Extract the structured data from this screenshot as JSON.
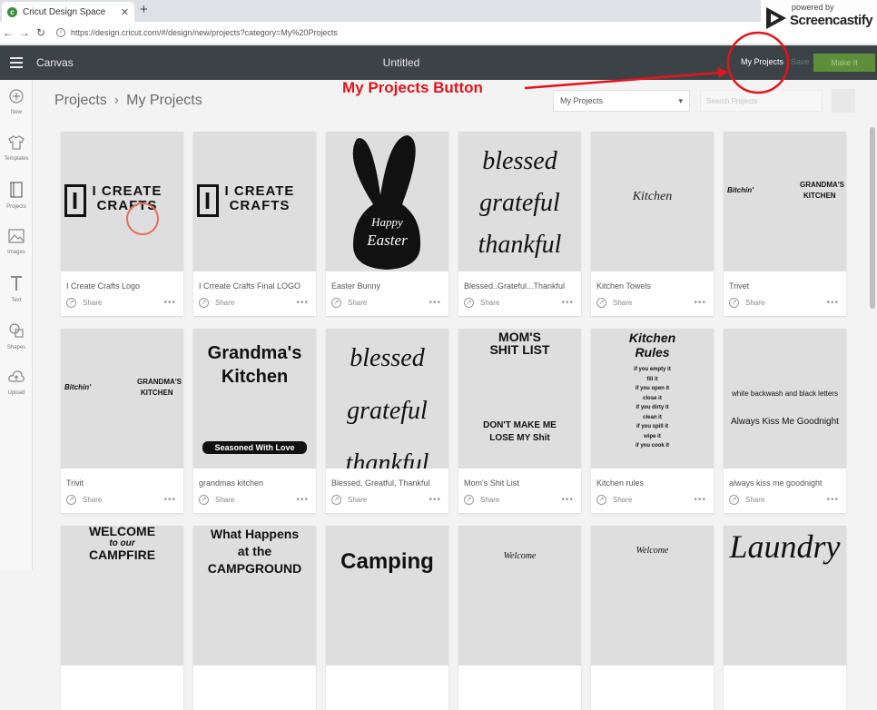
{
  "browser": {
    "tab_title": "Cricut Design Space",
    "url": "https://design.cricut.com/#/design/new/projects?category=My%20Projects"
  },
  "watermark": {
    "powered": "powered by",
    "brand": "Screencastify"
  },
  "appbar": {
    "canvas_label": "Canvas",
    "title": "Untitled",
    "my_projects": "My Projects",
    "save": "Save",
    "make_it": "Make It"
  },
  "sidebar": {
    "items": [
      {
        "label": "New",
        "icon": "plus-icon"
      },
      {
        "label": "Templates",
        "icon": "shirt-icon"
      },
      {
        "label": "Projects",
        "icon": "projects-icon"
      },
      {
        "label": "Images",
        "icon": "image-icon"
      },
      {
        "label": "Text",
        "icon": "text-icon"
      },
      {
        "label": "Shapes",
        "icon": "shapes-icon"
      },
      {
        "label": "Upload",
        "icon": "upload-icon"
      }
    ]
  },
  "header": {
    "crumb_root": "Projects",
    "crumb_sep": "›",
    "crumb_current": "My Projects",
    "select_value": "My Projects",
    "search_placeholder": "Search Projects"
  },
  "annotation": {
    "label": "My Projects Button"
  },
  "share_label": "Share",
  "more_label": "•••",
  "projects": [
    {
      "name": "I Create Crafts Logo",
      "art": [
        "I CREATE",
        "CRAFTS"
      ]
    },
    {
      "name": "I Crreate Crafts Final LOGO",
      "art": [
        "I CREATE",
        "CRAFTS"
      ]
    },
    {
      "name": "Easter Bunny",
      "art": [
        "Happy",
        "Easter"
      ]
    },
    {
      "name": "Blessed..Grateful...Thankful",
      "art": [
        "blessed",
        "grateful",
        "thankful"
      ]
    },
    {
      "name": "Kitchen Towels",
      "art": [
        "Kitchen"
      ]
    },
    {
      "name": "Trivet",
      "art": [
        "Bitchin'",
        "GRANDMA'S",
        "KITCHEN"
      ]
    },
    {
      "name": "Trivit",
      "art": [
        "Bitchin'",
        "GRANDMA'S",
        "KITCHEN"
      ]
    },
    {
      "name": "grandmas kitchen",
      "art": [
        "Grandma's",
        "Kitchen",
        "Seasoned With Love"
      ]
    },
    {
      "name": "Blessed, Greatful, Thankful",
      "art": [
        "blessed",
        "grateful",
        "thankful"
      ]
    },
    {
      "name": "Mom's Shit List",
      "art": [
        "MOM'S",
        "SHIT LIST",
        "DON'T MAKE ME",
        "LOSE MY Shit"
      ]
    },
    {
      "name": "Kitchen rules",
      "art": [
        "Kitchen",
        "Rules",
        "if you empty it",
        "fill it",
        "if you open it",
        "close it",
        "if you dirty it",
        "clean it",
        "if you spill it",
        "wipe it",
        "if you cook it"
      ]
    },
    {
      "name": "always kiss me goodnight",
      "art": [
        "white backwash and black letters",
        "Always Kiss Me Goodnight"
      ]
    },
    {
      "name": "",
      "art": [
        "WELCOME",
        "to our",
        "CAMPFIRE"
      ]
    },
    {
      "name": "",
      "art": [
        "What Happens",
        "at the",
        "CAMPGROUND"
      ]
    },
    {
      "name": "",
      "art": [
        "Camping"
      ]
    },
    {
      "name": "",
      "art": [
        "Welcome"
      ]
    },
    {
      "name": "",
      "art": [
        "Welcome"
      ]
    },
    {
      "name": "",
      "art": [
        "Laundry"
      ]
    }
  ]
}
